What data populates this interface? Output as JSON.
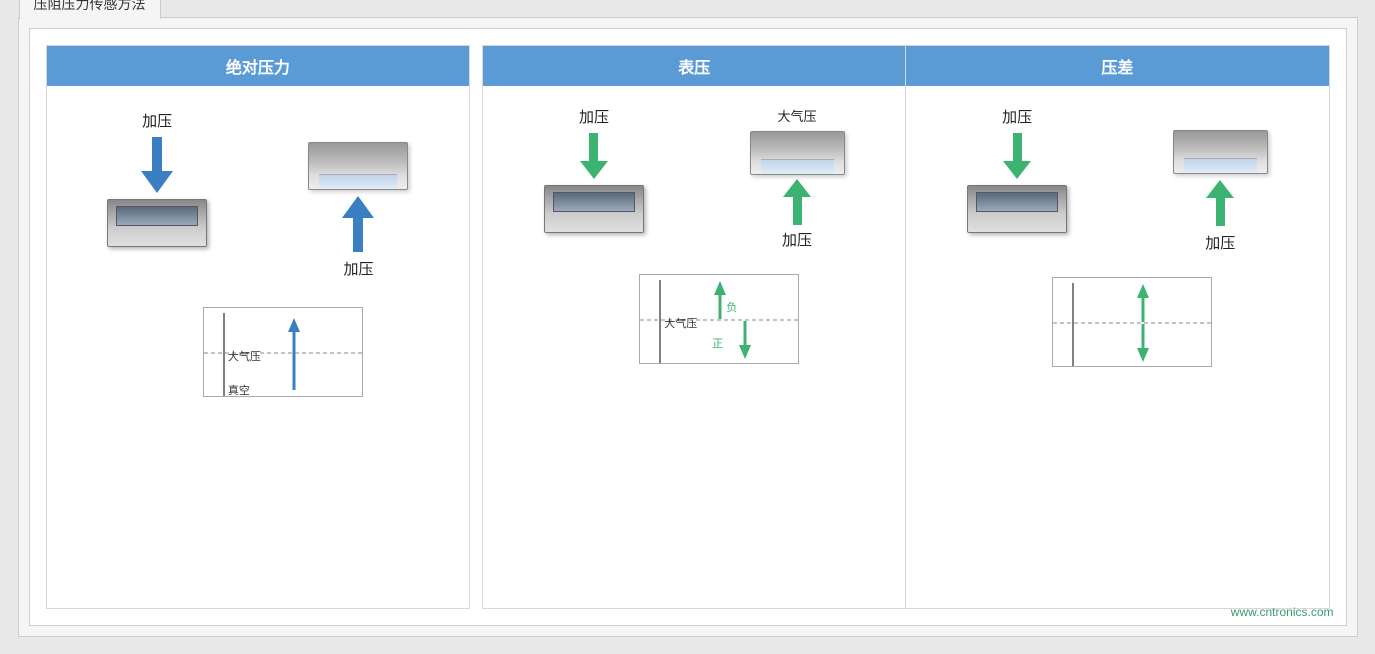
{
  "page": {
    "title": "压阻压力传感方法",
    "watermark": "www.cntronics.com"
  },
  "panels": {
    "absolute": {
      "header": "绝对压力",
      "label_top": "加压",
      "label_bottom": "加压",
      "chart_labels": {
        "atmosphere": "大气压",
        "vacuum": "真空"
      }
    },
    "gauge": {
      "header": "表压",
      "label_top": "加压",
      "label_atmosphere": "大气压",
      "label_bottom": "加压",
      "chart_labels": {
        "atmosphere": "大气压",
        "positive": "正",
        "negative": "负"
      }
    },
    "differential": {
      "header": "压差",
      "label_top": "加压",
      "label_bottom": "加压"
    }
  }
}
